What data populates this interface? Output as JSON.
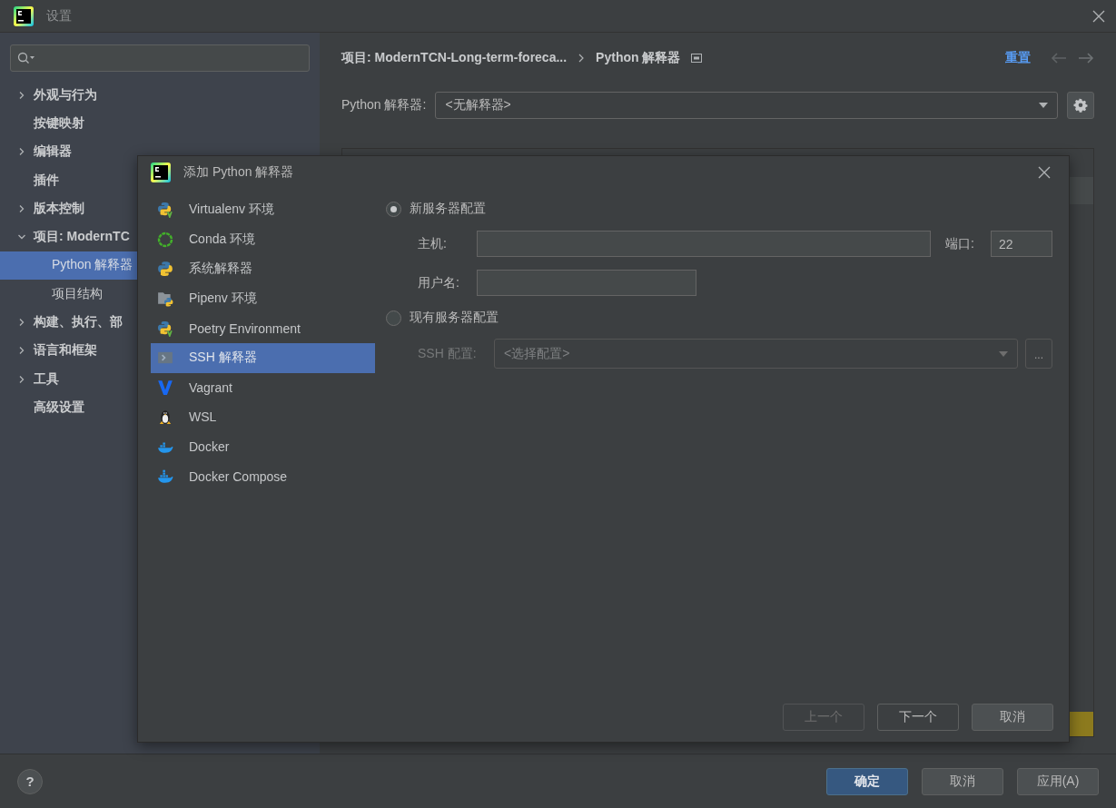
{
  "window": {
    "title": "设置"
  },
  "sidebar": {
    "items": [
      {
        "label": "外观与行为",
        "kind": "group",
        "expanded": false,
        "selected": false
      },
      {
        "label": "按键映射",
        "kind": "leaf",
        "selected": false
      },
      {
        "label": "编辑器",
        "kind": "group",
        "expanded": false,
        "selected": false
      },
      {
        "label": "插件",
        "kind": "leaf",
        "selected": false
      },
      {
        "label": "版本控制",
        "kind": "group",
        "expanded": false,
        "selected": false
      },
      {
        "label": "项目: ModernTC",
        "kind": "group",
        "expanded": true,
        "selected": false,
        "children": [
          {
            "label": "Python 解释器",
            "selected": true
          },
          {
            "label": "项目结构",
            "selected": false
          }
        ]
      },
      {
        "label": "构建、执行、部",
        "kind": "group",
        "expanded": false,
        "selected": false
      },
      {
        "label": "语言和框架",
        "kind": "group",
        "expanded": false,
        "selected": false
      },
      {
        "label": "工具",
        "kind": "group",
        "expanded": false,
        "selected": false
      },
      {
        "label": "高级设置",
        "kind": "leaf",
        "selected": false
      }
    ]
  },
  "breadcrumb": {
    "items": [
      "项目: ModernTCN-Long-term-foreca...",
      "Python 解释器"
    ],
    "reset": "重置"
  },
  "interpreter": {
    "label": "Python 解释器:",
    "value": "<无解释器>"
  },
  "dialog": {
    "title": "添加 Python 解释器",
    "types": [
      {
        "label": "Virtualenv 环境",
        "kind": "virtualenv",
        "selected": false
      },
      {
        "label": "Conda 环境",
        "kind": "conda",
        "selected": false
      },
      {
        "label": "系统解释器",
        "kind": "python",
        "selected": false
      },
      {
        "label": "Pipenv 环境",
        "kind": "pipenv",
        "selected": false
      },
      {
        "label": "Poetry Environment",
        "kind": "virtualenv",
        "selected": false
      },
      {
        "label": "SSH 解释器",
        "kind": "ssh",
        "selected": true
      },
      {
        "label": "Vagrant",
        "kind": "vagrant",
        "selected": false
      },
      {
        "label": "WSL",
        "kind": "wsl",
        "selected": false
      },
      {
        "label": "Docker",
        "kind": "docker",
        "selected": false
      },
      {
        "label": "Docker Compose",
        "kind": "compose",
        "selected": false
      }
    ],
    "new_server": {
      "label": "新服务器配置",
      "selected": true,
      "host": {
        "label": "主机:"
      },
      "port": {
        "label": "端口:",
        "value": "22"
      },
      "username": {
        "label": "用户名:"
      }
    },
    "existing_server": {
      "label": "现有服务器配置",
      "selected": false,
      "ssh_config": {
        "label": "SSH 配置:",
        "placeholder": "<选择配置>",
        "disabled": true
      },
      "browse": "..."
    },
    "buttons": [
      {
        "label": "上一个",
        "kind": "outline",
        "disabled": true
      },
      {
        "label": "下一个",
        "kind": "outline",
        "disabled": false
      },
      {
        "label": "取消",
        "kind": "filled",
        "disabled": false
      }
    ]
  },
  "footer": {
    "help": "?",
    "buttons": [
      {
        "label": "确定",
        "kind": "primary"
      },
      {
        "label": "取消",
        "kind": "normal"
      },
      {
        "label": "应用(A)",
        "kind": "normal"
      }
    ]
  }
}
